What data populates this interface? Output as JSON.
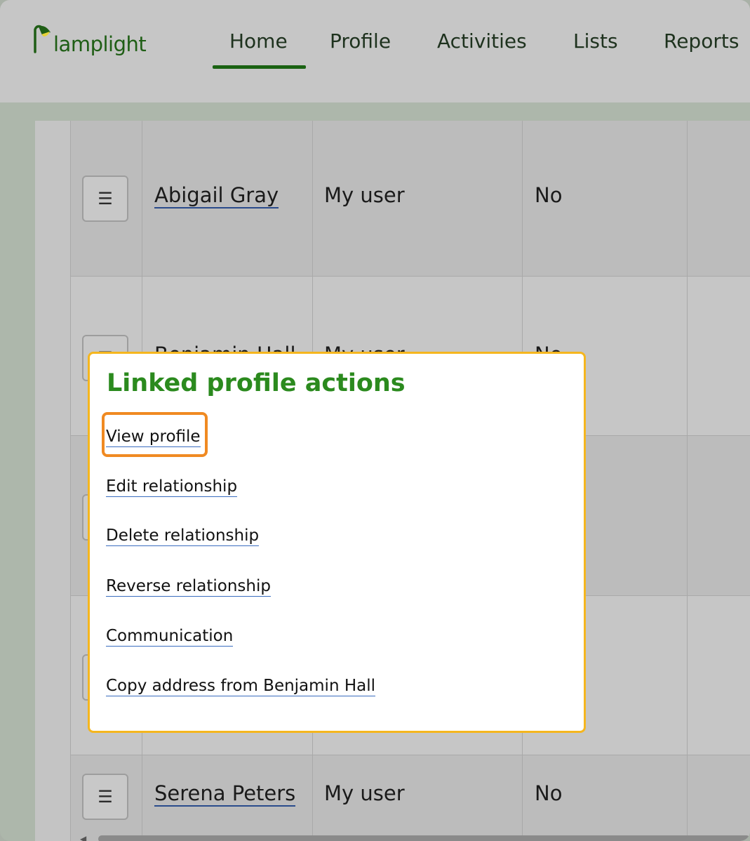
{
  "app": {
    "logo_text": "lamplight"
  },
  "nav": {
    "tabs": [
      {
        "label": "Home",
        "active": true
      },
      {
        "label": "Profile"
      },
      {
        "label": "Activities"
      },
      {
        "label": "Lists"
      },
      {
        "label": "Reports"
      }
    ]
  },
  "table": {
    "rows": [
      {
        "name": "Abigail Gray",
        "relationship": "My user",
        "col3": "No"
      },
      {
        "name": "Benjamin Hall",
        "relationship": "My user",
        "col3": "No"
      },
      {
        "name": "",
        "relationship": "",
        "col3": ""
      },
      {
        "name": "",
        "relationship": "",
        "col3": ""
      },
      {
        "name": "Serena Peters",
        "relationship": "My user",
        "col3": "No"
      }
    ],
    "row_menu_icon": "☰"
  },
  "popup": {
    "title": "Linked profile actions",
    "actions": [
      "View profile",
      "Edit relationship",
      "Delete relationship",
      "Reverse relationship",
      "Communication",
      "Copy address from Benjamin Hall"
    ],
    "highlighted_action": "View profile"
  },
  "colors": {
    "brand_green": "#1a6212",
    "popup_title": "#2b8a1e",
    "popup_border": "#f5b61e",
    "highlight": "#f08a22",
    "link_underline": "#3a6dbf"
  }
}
